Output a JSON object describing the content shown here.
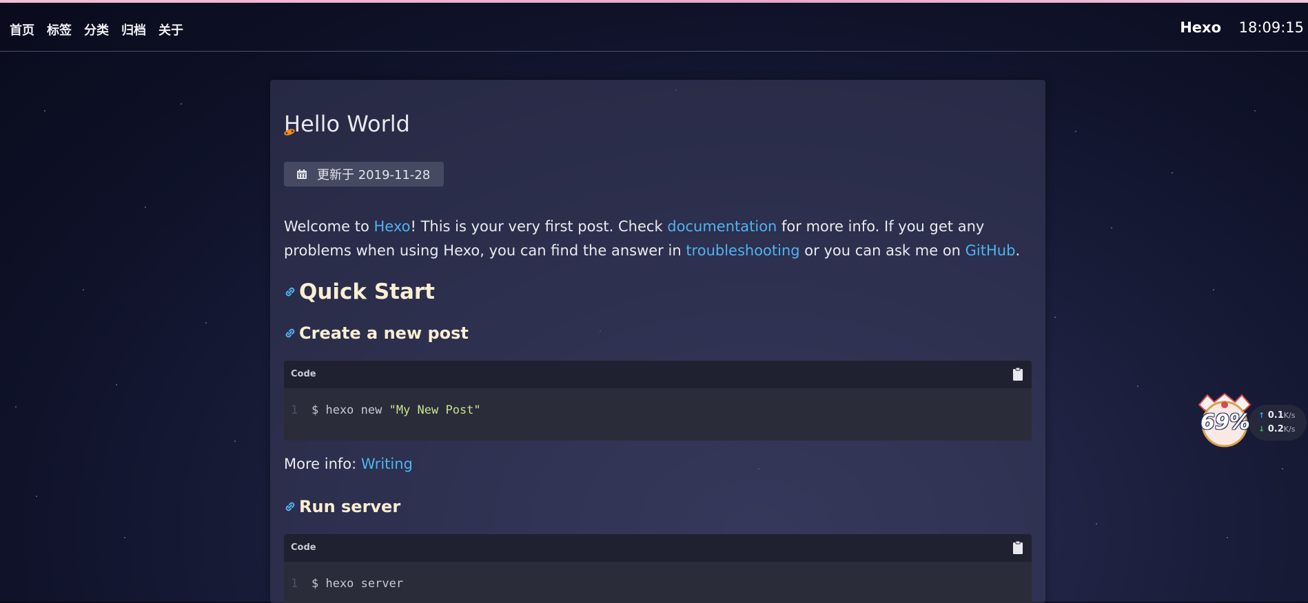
{
  "nav": {
    "links": [
      "首页",
      "标签",
      "分类",
      "归档",
      "关于"
    ],
    "brand": "Hexo",
    "clock": "18:09:15"
  },
  "post": {
    "title": "Hello World",
    "updated_label": "更新于 2019-11-28",
    "intro": {
      "t1": "Welcome to ",
      "hexo_link": "Hexo",
      "t2": "! This is your very first post. Check ",
      "doc_link": "documentation",
      "t3": " for more info. If you get any problems when using Hexo, you can find the answer in ",
      "troubleshooting_link": "troubleshooting",
      "t4": " or you can ask me on ",
      "github_link": "GitHub",
      "t5": "."
    },
    "h2_quick_start": "Quick Start",
    "h3_create_post": "Create a new post",
    "code_label": "Code",
    "code1": {
      "line": "1",
      "prefix": "$ hexo new ",
      "string": "\"My New Post\""
    },
    "more_info_label": "More info: ",
    "more_info_link": "Writing",
    "h3_run_server": "Run server",
    "code2": {
      "line": "1",
      "text": "$ hexo server"
    }
  },
  "widget": {
    "percent": "69%",
    "upload": "0.1",
    "download": "0.2",
    "unit": "K/s"
  },
  "colors": {
    "link": "#4fb3f0",
    "heading": "#fbeed2",
    "string": "#c7e58b"
  }
}
